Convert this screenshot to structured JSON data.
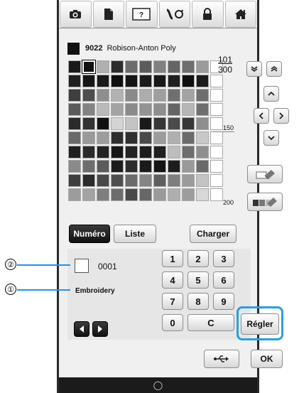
{
  "thread": {
    "code": "9022",
    "name": "Robison-Anton Poly"
  },
  "counter": {
    "numerator": "101",
    "denominator": "300"
  },
  "ticks": [
    "150",
    "200"
  ],
  "tabs": [
    "camera-icon",
    "page-icon",
    "help-icon",
    "hoop-icon",
    "lock-icon",
    "home-icon"
  ],
  "toggle": {
    "numero": "Numéro",
    "liste": "Liste"
  },
  "charger": "Charger",
  "swatch_value": "0001",
  "brand": "Embroidery",
  "keypad": [
    "1",
    "2",
    "3",
    "4",
    "5",
    "6",
    "7",
    "8",
    "9",
    "0",
    "C"
  ],
  "regler": "Régler",
  "ok": "OK",
  "callouts": [
    "②",
    "①"
  ],
  "palette": [
    [
      "#1a1a1a",
      "#121212",
      "#b0b0b0",
      "#2d2d2d",
      "#6c6c6c",
      "#5b5b5b",
      "#818181",
      "#656565",
      "#6e6e6e",
      "#9a9a9a",
      "#ffffff"
    ],
    [
      "#1f1f1f",
      "#161616",
      "#1a1a1a",
      "#0f0f0f",
      "#151515",
      "#1b1b1b",
      "#191919",
      "#1f1f1f",
      "#0f0f0f",
      "#1b1b1b",
      "#ffffff"
    ],
    [
      "#3e3e3e",
      "#4d4d4d",
      "#8e8e8e",
      "#b2b2b2",
      "#8a8a8a",
      "#adadad",
      "#9f9f9f",
      "#6f6f6f",
      "#a3a3a3",
      "#6e6e6e",
      "#ffffff"
    ],
    [
      "#5b5b5b",
      "#838383",
      "#b9b9b9",
      "#a3a3a3",
      "#8a8a8a",
      "#939393",
      "#8e8e8e",
      "#656565",
      "#b6b6b6",
      "#6f6f6f",
      "#ffffff"
    ],
    [
      "#2a2a2a",
      "#323232",
      "#121212",
      "#d4d4d4",
      "#c4c4c4",
      "#1a1a1a",
      "#363636",
      "#4b4b4b",
      "#373737",
      "#8e8e8e",
      "#ffffff"
    ],
    [
      "#6a6a6a",
      "#9a9a9a",
      "#9d9d9d",
      "#2e2e2e",
      "#2f2f2f",
      "#494949",
      "#9c9c9c",
      "#afafaf",
      "#6b6b6b",
      "#c8c8c8",
      "#ffffff"
    ],
    [
      "#1f1f1f",
      "#2b2b2b",
      "#232323",
      "#161616",
      "#242424",
      "#1c1c1c",
      "#202020",
      "#bdbdbd",
      "#6d6d6d",
      "#8e8e8e",
      "#ffffff"
    ],
    [
      "#8a8a8a",
      "#6d6d6d",
      "#5b5b5b",
      "#1d1d1d",
      "#2c2c2c",
      "#1a1a1a",
      "#141414",
      "#1d1d1d",
      "#999999",
      "#6a6a6a",
      "#ffffff"
    ],
    [
      "#3f3f3f",
      "#2b2b2b",
      "#494949",
      "#4e4e4e",
      "#6b6b6b",
      "#848484",
      "#5f5f5f",
      "#7e7e7e",
      "#9b9b9b",
      "#c3c3c3",
      "#ffffff"
    ],
    [
      "#9c9c9c",
      "#a3a3a3",
      "#7e7e7e",
      "#6d6d6d",
      "#4a4a4a",
      "#676767",
      "#9a9a9a",
      "#afafaf",
      "#9d9d9d",
      "#d8d8d8",
      "#ffffff"
    ]
  ]
}
